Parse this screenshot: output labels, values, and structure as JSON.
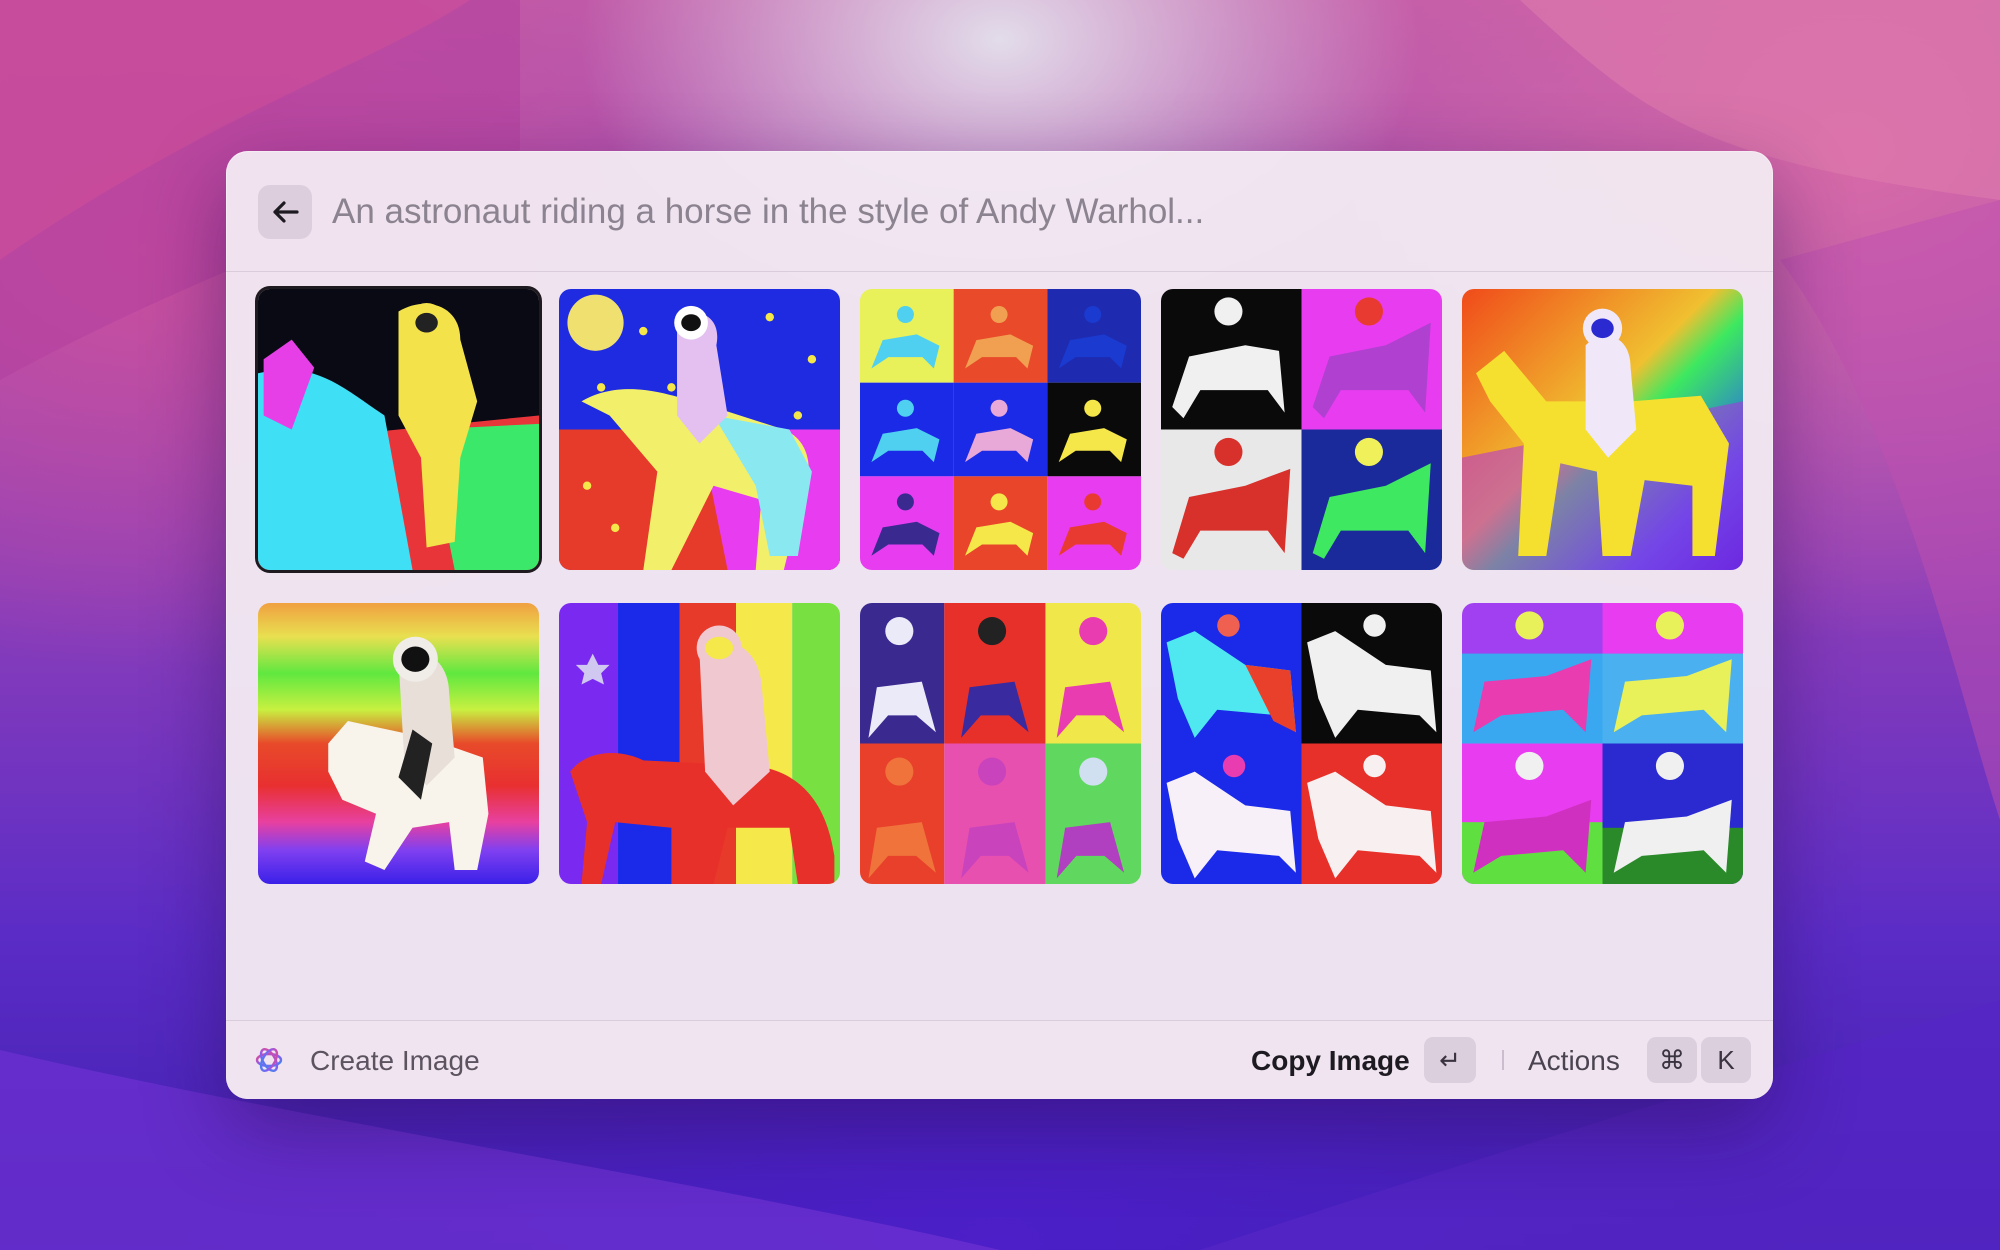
{
  "search": {
    "placeholder": "An astronaut riding a horse in the style of Andy Warhol..."
  },
  "icons": {
    "back": "arrow-left-icon",
    "command": "openai-logo-icon",
    "return_key": "return-key-icon"
  },
  "results": {
    "count": 10,
    "selected_index": 0
  },
  "footer": {
    "command_title": "Create Image",
    "primary_action": "Copy Image",
    "return_symbol": "↵",
    "actions_label": "Actions",
    "cmd_symbol": "⌘",
    "k_symbol": "K"
  },
  "colors": {
    "window_bg": "#f2e8f2",
    "text_primary": "#1e1a22",
    "text_secondary": "#5b5460",
    "selection_border": "#1e1a20"
  }
}
